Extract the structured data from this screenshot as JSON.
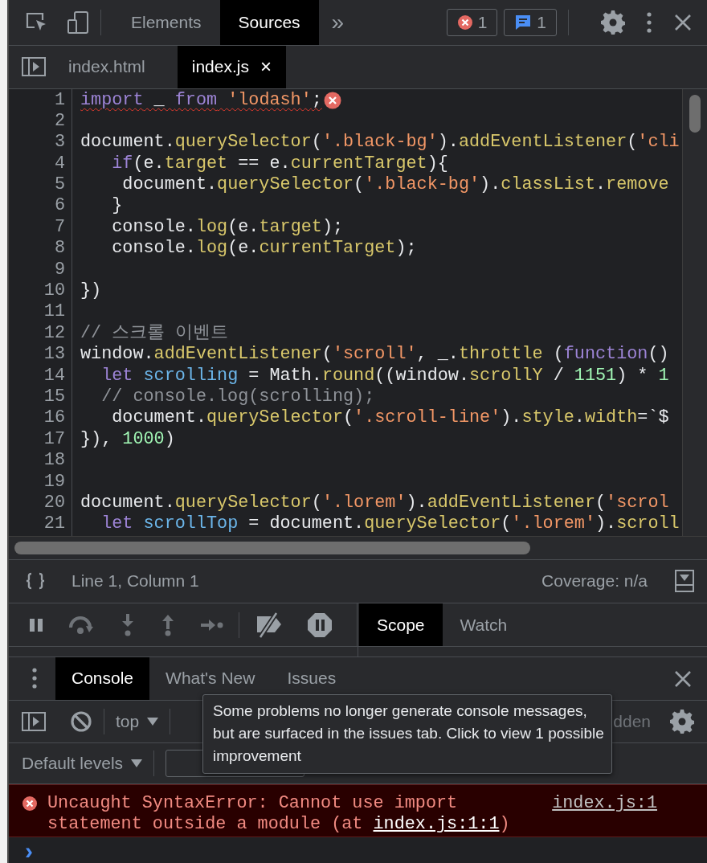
{
  "toolbar": {
    "tabs": [
      {
        "label": "Elements",
        "selected": false
      },
      {
        "label": "Sources",
        "selected": true
      }
    ],
    "more": "»",
    "error_count": "1",
    "message_count": "1"
  },
  "file_tabs": [
    {
      "label": "index.html",
      "selected": false
    },
    {
      "label": "index.js",
      "selected": true,
      "close": "×"
    }
  ],
  "editor": {
    "lines": [
      {
        "number": "1",
        "error": true,
        "tokens": [
          {
            "kind": "keyword",
            "text": "import"
          },
          {
            "kind": "plain",
            "text": " _ "
          },
          {
            "kind": "keyword",
            "text": "from"
          },
          {
            "kind": "string",
            "text": " 'lodash'"
          },
          {
            "kind": "plain",
            "text": ";"
          }
        ]
      },
      {
        "number": "2"
      },
      {
        "number": "3",
        "error": false,
        "tokens": [
          {
            "kind": "plain",
            "text": "document."
          },
          {
            "kind": "method",
            "text": "querySelector"
          },
          {
            "kind": "plain",
            "text": "("
          },
          {
            "kind": "string",
            "text": "'.black-bg'"
          },
          {
            "kind": "plain",
            "text": ")."
          },
          {
            "kind": "method",
            "text": "addEventListener"
          },
          {
            "kind": "plain",
            "text": "("
          },
          {
            "kind": "string",
            "text": "'cli"
          }
        ]
      },
      {
        "number": "4",
        "error": false,
        "tokens": [
          {
            "kind": "keyword",
            "text": "   if"
          },
          {
            "kind": "plain",
            "text": "(e."
          },
          {
            "kind": "method",
            "text": "target"
          },
          {
            "kind": "plain",
            "text": " == e."
          },
          {
            "kind": "method",
            "text": "currentTarget"
          },
          {
            "kind": "plain",
            "text": "){"
          }
        ]
      },
      {
        "number": "5",
        "error": false,
        "tokens": [
          {
            "kind": "plain",
            "text": "    document."
          },
          {
            "kind": "method",
            "text": "querySelector"
          },
          {
            "kind": "plain",
            "text": "("
          },
          {
            "kind": "string",
            "text": "'.black-bg'"
          },
          {
            "kind": "plain",
            "text": ")."
          },
          {
            "kind": "method",
            "text": "classList"
          },
          {
            "kind": "plain",
            "text": "."
          },
          {
            "kind": "method",
            "text": "remove"
          }
        ]
      },
      {
        "number": "6",
        "error": false,
        "tokens": [
          {
            "kind": "plain",
            "text": "   }"
          }
        ]
      },
      {
        "number": "7",
        "error": false,
        "tokens": [
          {
            "kind": "plain",
            "text": "   console."
          },
          {
            "kind": "method",
            "text": "log"
          },
          {
            "kind": "plain",
            "text": "(e."
          },
          {
            "kind": "method",
            "text": "target"
          },
          {
            "kind": "plain",
            "text": ");"
          }
        ]
      },
      {
        "number": "8",
        "error": false,
        "tokens": [
          {
            "kind": "plain",
            "text": "   console."
          },
          {
            "kind": "method",
            "text": "log"
          },
          {
            "kind": "plain",
            "text": "(e."
          },
          {
            "kind": "method",
            "text": "currentTarget"
          },
          {
            "kind": "plain",
            "text": ");"
          }
        ]
      },
      {
        "number": "9"
      },
      {
        "number": "10",
        "error": false,
        "tokens": [
          {
            "kind": "plain",
            "text": "})"
          }
        ]
      },
      {
        "number": "11"
      },
      {
        "number": "12",
        "error": false,
        "tokens": [
          {
            "kind": "comment",
            "text": "// 스크롤 이벤트"
          }
        ]
      },
      {
        "number": "13",
        "error": false,
        "tokens": [
          {
            "kind": "plain",
            "text": "window."
          },
          {
            "kind": "method",
            "text": "addEventListener"
          },
          {
            "kind": "plain",
            "text": "("
          },
          {
            "kind": "string",
            "text": "'scroll'"
          },
          {
            "kind": "plain",
            "text": ", _."
          },
          {
            "kind": "method",
            "text": "throttle"
          },
          {
            "kind": "plain",
            "text": " ("
          },
          {
            "kind": "keyword",
            "text": "function"
          },
          {
            "kind": "plain",
            "text": "()"
          }
        ]
      },
      {
        "number": "14",
        "error": false,
        "tokens": [
          {
            "kind": "keyword",
            "text": "  let"
          },
          {
            "kind": "variable",
            "text": " scrolling"
          },
          {
            "kind": "plain",
            "text": " = Math."
          },
          {
            "kind": "method",
            "text": "round"
          },
          {
            "kind": "plain",
            "text": "((window."
          },
          {
            "kind": "method",
            "text": "scrollY"
          },
          {
            "kind": "plain",
            "text": " / "
          },
          {
            "kind": "number",
            "text": "1151"
          },
          {
            "kind": "plain",
            "text": ") * "
          },
          {
            "kind": "number",
            "text": "1"
          }
        ]
      },
      {
        "number": "15",
        "error": false,
        "tokens": [
          {
            "kind": "comment",
            "text": "  // console.log(scrolling);"
          }
        ]
      },
      {
        "number": "16",
        "error": false,
        "tokens": [
          {
            "kind": "plain",
            "text": "   document."
          },
          {
            "kind": "method",
            "text": "querySelector"
          },
          {
            "kind": "plain",
            "text": "("
          },
          {
            "kind": "string",
            "text": "'.scroll-line'"
          },
          {
            "kind": "plain",
            "text": ")."
          },
          {
            "kind": "method",
            "text": "style"
          },
          {
            "kind": "plain",
            "text": "."
          },
          {
            "kind": "method",
            "text": "width"
          },
          {
            "kind": "plain",
            "text": "=`$"
          }
        ]
      },
      {
        "number": "17",
        "error": false,
        "tokens": [
          {
            "kind": "plain",
            "text": "}), "
          },
          {
            "kind": "number",
            "text": "1000"
          },
          {
            "kind": "plain",
            "text": ")"
          }
        ]
      },
      {
        "number": "18"
      },
      {
        "number": "19"
      },
      {
        "number": "20",
        "error": false,
        "tokens": [
          {
            "kind": "plain",
            "text": "document."
          },
          {
            "kind": "method",
            "text": "querySelector"
          },
          {
            "kind": "plain",
            "text": "("
          },
          {
            "kind": "string",
            "text": "'.lorem'"
          },
          {
            "kind": "plain",
            "text": ")."
          },
          {
            "kind": "method",
            "text": "addEventListener"
          },
          {
            "kind": "plain",
            "text": "("
          },
          {
            "kind": "string",
            "text": "'scrol"
          }
        ]
      },
      {
        "number": "21",
        "error": false,
        "tokens": [
          {
            "kind": "keyword",
            "text": "  let"
          },
          {
            "kind": "variable",
            "text": " scrollTop"
          },
          {
            "kind": "plain",
            "text": " = document."
          },
          {
            "kind": "method",
            "text": "querySelector"
          },
          {
            "kind": "plain",
            "text": "("
          },
          {
            "kind": "string",
            "text": "'.lorem'"
          },
          {
            "kind": "plain",
            "text": ")."
          },
          {
            "kind": "method",
            "text": "scroll"
          }
        ]
      }
    ]
  },
  "status_bar": {
    "position": "Line 1, Column 1",
    "coverage": "Coverage: n/a"
  },
  "sidebar_tabs": [
    {
      "label": "Scope",
      "selected": true
    },
    {
      "label": "Watch",
      "selected": false
    }
  ],
  "drawer_tabs": [
    {
      "label": "Console",
      "selected": true
    },
    {
      "label": "What's New",
      "selected": false
    },
    {
      "label": "Issues",
      "selected": false
    }
  ],
  "console_toolbar": {
    "context": "top",
    "hidden_fragment": "dden",
    "levels": "Default levels"
  },
  "tooltip": "Some problems no longer generate console messages, but are surfaced in the issues tab. Click to view 1 possible improvement",
  "console": {
    "message": {
      "kind": "error",
      "text": "Uncaught SyntaxError: Cannot use import statement outside a module (at ",
      "link": "index.js:1:1",
      "text_after": ")",
      "source": "index.js:1"
    },
    "prompt": "›"
  }
}
